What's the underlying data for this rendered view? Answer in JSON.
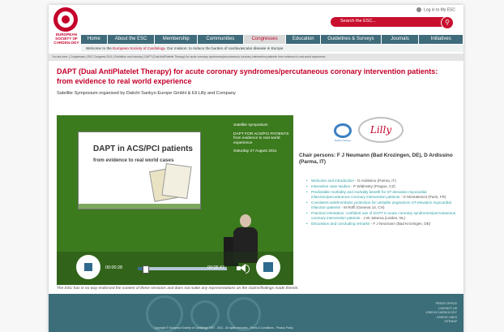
{
  "header": {
    "brand_lines": [
      "EUROPEAN",
      "SOCIETY OF",
      "CARDIOLOGY"
    ],
    "login_label": "Log in to My ESC",
    "search_placeholder": "Search the ESC..."
  },
  "nav": {
    "items": [
      {
        "label": "Home"
      },
      {
        "label": "About the ESC"
      },
      {
        "label": "Membership"
      },
      {
        "label": "Communities"
      },
      {
        "label": "Congresses",
        "active": true
      },
      {
        "label": "Education"
      },
      {
        "label": "Guidelines & Surveys"
      },
      {
        "label": "Journals"
      },
      {
        "label": "Initiatives"
      }
    ]
  },
  "mission": {
    "prefix": "Welcome to the ",
    "link": "European Society of Cardiology",
    "suffix": ". Our mission: to reduce the burden of cardiovascular disease in Europe"
  },
  "breadcrumb": "You are here: | Congresses | ESC Congress 2011 | Exhibition and Industry | DAPT (Dual AntiPlatelet Therapy) for acute coronary syndromes/percutaneous coronary intervention patients: from evidence to real world experience",
  "page": {
    "title": "DAPT (Dual AntiPlatelet Therapy) for acute coronary syndromes/percutaneous coronary intervention patients: from evidence to real world experience",
    "subtitle": "Satellite Symposium organised by Daiichi Sankyo Europe GmbH & Eli Lilly and Company"
  },
  "video": {
    "slide_title": "DAPT in ACS/PCI patients",
    "slide_subtitle": "from evidence to real world cases",
    "side_lines": [
      "Satellite symposium",
      "DAPT FOR ACS/PCI PATIENTS from evidence to real world experience",
      "Saturday 27 August 2011"
    ],
    "time_elapsed": "00:00:28",
    "time_total": "00:05:47",
    "progress": 0.08
  },
  "sponsors": {
    "sponsor1": "Daiichi-Sankyo",
    "sponsor2": "Lilly"
  },
  "chairs": "Chair persons: F J Neumann (Bad Krozingen, DE), D Ardissino (Parma, IT)",
  "program": [
    {
      "title": "Welcome and introduction",
      "speaker": " - D Ardissino (Parma, IT)"
    },
    {
      "title": "Interactive case studies",
      "speaker": " - P Widimsky (Prague, CZ)"
    },
    {
      "title": "Predictable morbidity and mortality benefit for ST-elevation myocardial infarction/percutaneous coronary intervention patients",
      "speaker": " - G Montalescot (Paris, FR)"
    },
    {
      "title": "Consistent antithrombotic protection for unstable angina/non ST-elevation myocardial infarction patients",
      "speaker": " - M Roffi (Geneva 14, CH)"
    },
    {
      "title": "Practical orientation: confident use of DAPT in acute coronary syndromes/percutaneous coronary intervention patients",
      "speaker": " - J W Jukema (Leiden, NL)"
    },
    {
      "title": "Discussion and concluding remarks",
      "speaker": " - F J Neumann (Bad Krozingen, DE)"
    }
  ],
  "disclaimer": "The ESC has in no way endorsed the content of these sessions and does not make any representations on the claims/findings made therein.",
  "footer": {
    "links": [
      "PRESS OFFICE",
      "CONTACT US",
      "JOBS IN CARDIOLOGY",
      "CARDIO LINKS",
      "SITEMAP"
    ],
    "copyright": "Copyright © European Society of Cardiology 1997 - 2011 - All rights reserved - Terms & Conditions - Privacy Policy"
  },
  "colors": {
    "brand_red": "#c4002a",
    "nav_teal": "#3f6b7a",
    "link_teal": "#2b9fa3",
    "video_green": "#3c7a1e"
  }
}
